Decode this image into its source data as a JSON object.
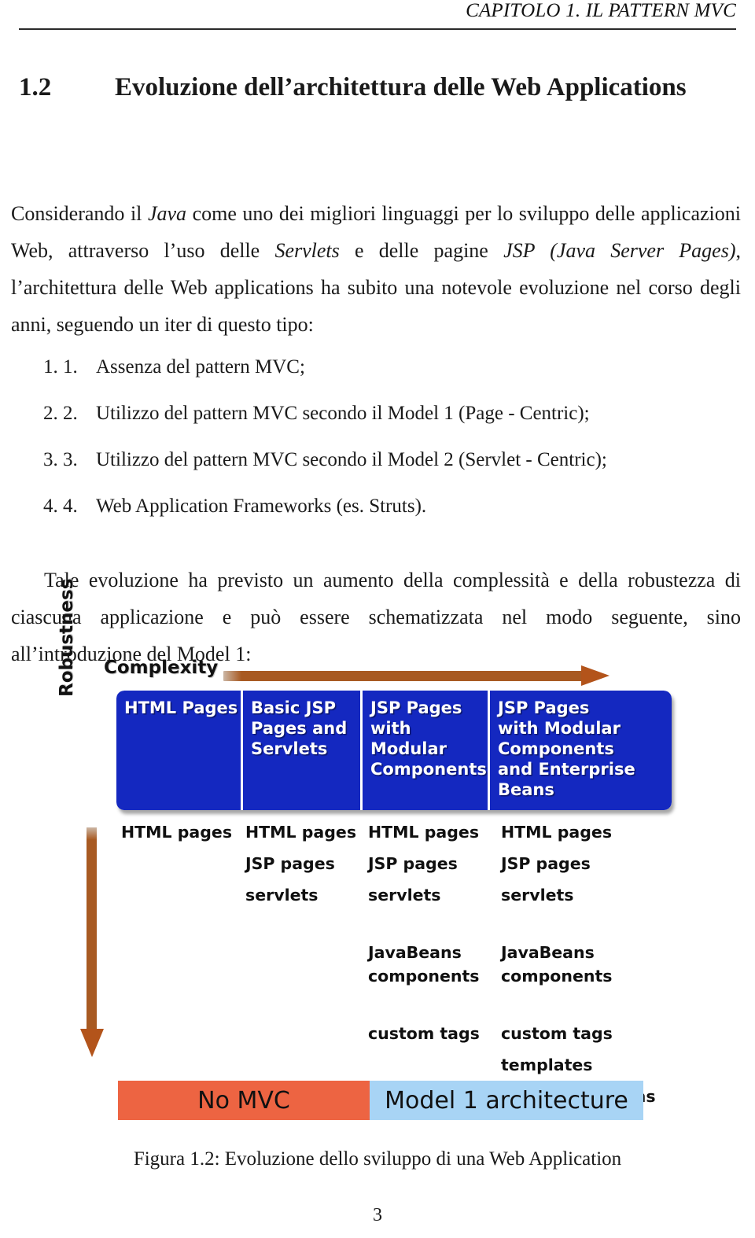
{
  "header": {
    "running_title": "CAPITOLO 1. IL PATTERN MVC"
  },
  "section": {
    "number": "1.2",
    "title": "Evoluzione dell’architettura delle Web Applications"
  },
  "paragraphs": {
    "intro_part1": "Considerando il ",
    "intro_java": "Java",
    "intro_part2": " come uno dei migliori linguaggi per lo sviluppo delle applicazioni Web, attraverso l’uso delle ",
    "intro_servlets": "Servlets",
    "intro_part3": " e delle pagine ",
    "intro_jsp": "JSP (Java Server Pages)",
    "intro_part4": ", l’architettura delle Web applications ha subito una notevole evoluzione nel corso degli anni, seguendo un iter di questo tipo:",
    "closing": "Tale evoluzione ha previsto un aumento della complessità e della robustezza di ciascuna applicazione e può essere schematizzata nel modo seguente, sino all’introduzione del Model 1:"
  },
  "list": [
    {
      "marker": "1.",
      "text": "Assenza del pattern MVC;"
    },
    {
      "marker": "2.",
      "text": "Utilizzo del pattern MVC secondo il Model 1 (Page - Centric);"
    },
    {
      "marker": "3.",
      "text": "Utilizzo del pattern MVC secondo il Model 2 (Servlet - Centric);"
    },
    {
      "marker": "4.",
      "text": "Web Application Frameworks (es. Struts)."
    }
  ],
  "figure": {
    "axis_x_label": "Complexity",
    "axis_y_label": "Robustness",
    "colors": {
      "arrow": "#b3541b",
      "box_blue": "#1428c0",
      "legend_orange": "#ed6442",
      "legend_lightblue": "#a8d4f5"
    },
    "stages": [
      {
        "box_lines": [
          "HTML Pages"
        ],
        "features": [
          "HTML pages"
        ]
      },
      {
        "box_lines": [
          "Basic JSP",
          "Pages and",
          "Servlets"
        ],
        "features": [
          "HTML pages",
          "JSP pages",
          "servlets"
        ]
      },
      {
        "box_lines": [
          "JSP Pages",
          "with Modular",
          "Components"
        ],
        "features": [
          "HTML pages",
          "JSP pages",
          "servlets",
          "JavaBeans",
          "components",
          "custom tags"
        ]
      },
      {
        "box_lines": [
          "JSP Pages",
          "with Modular",
          "Components",
          "and Enterprise",
          "Beans"
        ],
        "features": [
          "HTML pages",
          "JSP pages",
          "servlets",
          "JavaBeans",
          "components",
          "custom tags",
          "templates",
          "enterprise beans"
        ]
      }
    ],
    "legend": [
      {
        "label": "No MVC"
      },
      {
        "label": "Model 1 architecture"
      }
    ]
  },
  "caption": "Figura 1.2: Evoluzione dello sviluppo di una Web Application",
  "folio": "3"
}
